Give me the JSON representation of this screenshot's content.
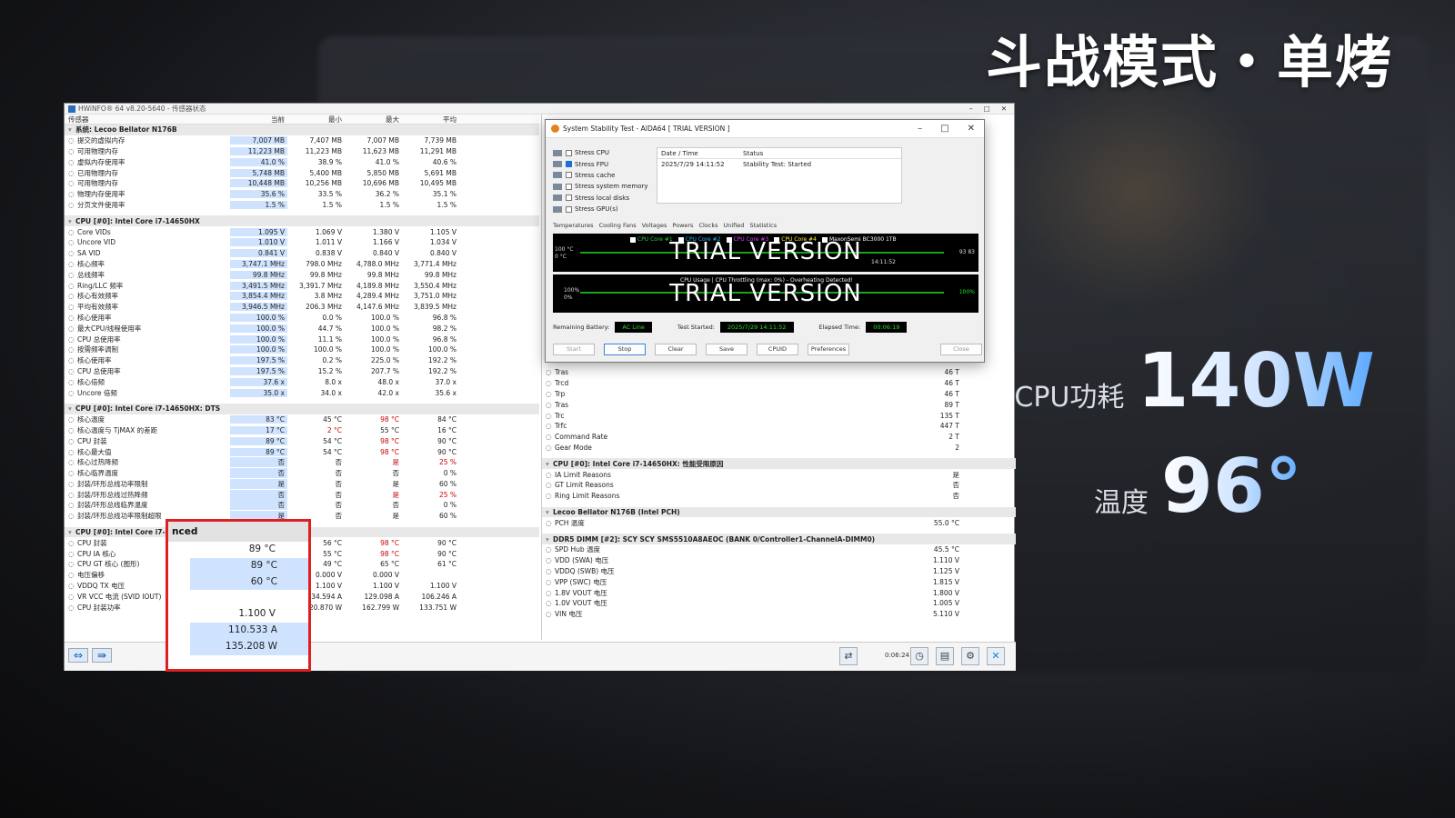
{
  "overlay": {
    "headline": "斗战模式・单烤",
    "cpu_power_label": "CPU功耗",
    "cpu_power_value": "140W",
    "temp_label": "温度",
    "temp_value": "96°"
  },
  "hwinfo": {
    "title": "HWiNFO® 64 v8.20-5640 - 传感器状态",
    "columns": [
      "传感器",
      "当前",
      "最小",
      "最大",
      "平均"
    ],
    "left_rows": [
      {
        "t": "g",
        "n": "系统: Lecoo Bellator N176B"
      },
      {
        "n": "提交的虚拟内存",
        "v": [
          "7,007 MB",
          "7,407 MB",
          "7,007 MB",
          "7,739 MB"
        ]
      },
      {
        "n": "可用物理内存",
        "v": [
          "11,223 MB",
          "11,223 MB",
          "11,623 MB",
          "11,291 MB"
        ]
      },
      {
        "n": "虚拟内存使用率",
        "v": [
          "41.0 %",
          "38.9 %",
          "41.0 %",
          "40.6 %"
        ]
      },
      {
        "n": "已用物理内存",
        "v": [
          "5,748 MB",
          "5,400 MB",
          "5,850 MB",
          "5,691 MB"
        ]
      },
      {
        "n": "可用物理内存",
        "v": [
          "10,448 MB",
          "10,256 MB",
          "10,696 MB",
          "10,495 MB"
        ]
      },
      {
        "n": "物理内存使用率",
        "v": [
          "35.6 %",
          "33.5 %",
          "36.2 %",
          "35.1 %"
        ]
      },
      {
        "n": "分页文件使用率",
        "v": [
          "1.5 %",
          "1.5 %",
          "1.5 %",
          "1.5 %"
        ]
      },
      {
        "t": "gap"
      },
      {
        "t": "g",
        "n": "CPU [#0]: Intel Core i7-14650HX"
      },
      {
        "n": "Core VIDs",
        "v": [
          "1.095 V",
          "1.069 V",
          "1.380 V",
          "1.105 V"
        ]
      },
      {
        "n": "Uncore VID",
        "v": [
          "1.010 V",
          "1.011 V",
          "1.166 V",
          "1.034 V"
        ]
      },
      {
        "n": "SA VID",
        "v": [
          "0.841 V",
          "0.838 V",
          "0.840 V",
          "0.840 V"
        ]
      },
      {
        "n": "核心频率",
        "v": [
          "3,747.1 MHz",
          "798.0 MHz",
          "4,788.0 MHz",
          "3,771.4 MHz"
        ]
      },
      {
        "n": "总线频率",
        "v": [
          "99.8 MHz",
          "99.8 MHz",
          "99.8 MHz",
          "99.8 MHz"
        ]
      },
      {
        "n": "Ring/LLC 频率",
        "v": [
          "3,491.5 MHz",
          "3,391.7 MHz",
          "4,189.8 MHz",
          "3,550.4 MHz"
        ]
      },
      {
        "n": "核心有效频率",
        "v": [
          "3,854.4 MHz",
          "3.8 MHz",
          "4,289.4 MHz",
          "3,751.0 MHz"
        ]
      },
      {
        "n": "平均有效频率",
        "v": [
          "3,946.5 MHz",
          "206.3 MHz",
          "4,147.6 MHz",
          "3,839.5 MHz"
        ]
      },
      {
        "n": "核心使用率",
        "v": [
          "100.0 %",
          "0.0 %",
          "100.0 %",
          "96.8 %"
        ]
      },
      {
        "n": "最大CPU/线程使用率",
        "v": [
          "100.0 %",
          "44.7 %",
          "100.0 %",
          "98.2 %"
        ]
      },
      {
        "n": "CPU 总使用率",
        "v": [
          "100.0 %",
          "11.1 %",
          "100.0 %",
          "96.8 %"
        ]
      },
      {
        "n": "按需频率调制",
        "v": [
          "100.0 %",
          "100.0 %",
          "100.0 %",
          "100.0 %"
        ]
      },
      {
        "n": "核心使用率",
        "v": [
          "197.5 %",
          "0.2 %",
          "225.0 %",
          "192.2 %"
        ]
      },
      {
        "n": "CPU 总使用率",
        "v": [
          "197.5 %",
          "15.2 %",
          "207.7 %",
          "192.2 %"
        ]
      },
      {
        "n": "核心倍频",
        "v": [
          "37.6 x",
          "8.0 x",
          "48.0 x",
          "37.0 x"
        ]
      },
      {
        "n": "Uncore 倍频",
        "v": [
          "35.0 x",
          "34.0 x",
          "42.0 x",
          "35.6 x"
        ]
      },
      {
        "t": "gap"
      },
      {
        "t": "g",
        "n": "CPU [#0]: Intel Core i7-14650HX: DTS"
      },
      {
        "n": "核心温度",
        "v": [
          "83 °C",
          "45 °C",
          "98 °C",
          "84 °C"
        ],
        "r": [
          2
        ]
      },
      {
        "n": "核心温度与 TjMAX 的差距",
        "v": [
          "17 °C",
          "2 °C",
          "55 °C",
          "16 °C"
        ],
        "r": [
          1
        ]
      },
      {
        "n": "CPU 封装",
        "v": [
          "89 °C",
          "54 °C",
          "98 °C",
          "90 °C"
        ],
        "r": [
          2
        ]
      },
      {
        "n": "核心最大值",
        "v": [
          "89 °C",
          "54 °C",
          "98 °C",
          "90 °C"
        ],
        "r": [
          2
        ]
      },
      {
        "n": "核心过热降频",
        "v": [
          "否",
          "否",
          "是",
          "25 %"
        ],
        "r": [
          2,
          3
        ]
      },
      {
        "n": "核心临界温度",
        "v": [
          "否",
          "否",
          "否",
          "0 %"
        ]
      },
      {
        "n": "封装/环形总线功率限制",
        "v": [
          "是",
          "否",
          "是",
          "60 %"
        ]
      },
      {
        "n": "封装/环形总线过热降频",
        "v": [
          "否",
          "否",
          "是",
          "25 %"
        ],
        "r": [
          2,
          3
        ]
      },
      {
        "n": "封装/环形总线临界温度",
        "v": [
          "否",
          "否",
          "否",
          "0 %"
        ]
      },
      {
        "n": "封装/环形总线功率限制超限",
        "v": [
          "是",
          "否",
          "是",
          "60 %"
        ]
      },
      {
        "t": "gap"
      },
      {
        "t": "g",
        "n": "CPU [#0]: Intel Core i7-14650HX: Enhanced"
      },
      {
        "n": "CPU 封装",
        "v": [
          "89 °C",
          "56 °C",
          "98 °C",
          "90 °C"
        ],
        "r": [
          2
        ]
      },
      {
        "n": "CPU IA 核心",
        "v": [
          "89 °C",
          "55 °C",
          "98 °C",
          "90 °C"
        ],
        "r": [
          2
        ]
      },
      {
        "n": "CPU GT 核心 (图形)",
        "v": [
          "60 °C",
          "49 °C",
          "65 °C",
          "61 °C"
        ]
      },
      {
        "n": "电压偏移",
        "v": [
          "",
          "0.000 V",
          "0.000 V",
          ""
        ]
      },
      {
        "n": "VDDQ TX 电压",
        "v": [
          "1.100 V",
          "1.100 V",
          "1.100 V",
          "1.100 V"
        ]
      },
      {
        "n": "VR VCC 电流 (SVID IOUT)",
        "v": [
          "110.533 A",
          "34.594 A",
          "129.098 A",
          "106.246 A"
        ]
      },
      {
        "n": "CPU 封装功率",
        "v": [
          "135.208 W",
          "20.870 W",
          "162.799 W",
          "133.751 W"
        ]
      }
    ],
    "right_rows": [
      {
        "n": "Tras",
        "v": "46 T"
      },
      {
        "n": "Trcd",
        "v": "46 T"
      },
      {
        "n": "Trp",
        "v": "46 T"
      },
      {
        "n": "Tras",
        "v": "89 T"
      },
      {
        "n": "Trc",
        "v": "135 T"
      },
      {
        "n": "Trfc",
        "v": "447 T"
      },
      {
        "n": "Command Rate",
        "v": "2 T"
      },
      {
        "n": "Gear Mode",
        "v": "2"
      },
      {
        "t": "gap"
      },
      {
        "t": "g",
        "n": "CPU [#0]: Intel Core i7-14650HX: 性能受限原因"
      },
      {
        "n": "IA Limit Reasons",
        "v": "是"
      },
      {
        "n": "GT Limit Reasons",
        "v": "否"
      },
      {
        "n": "Ring Limit Reasons",
        "v": "否"
      },
      {
        "t": "gap"
      },
      {
        "t": "g",
        "n": "Lecoo Bellator N176B (Intel PCH)"
      },
      {
        "n": "PCH 温度",
        "v": "55.0 °C"
      },
      {
        "t": "gap"
      },
      {
        "t": "g",
        "n": "DDR5 DIMM [#2]: SCY SCY SMS5510A8AEOC (BANK 0/Controller1-ChannelA-DIMM0)"
      },
      {
        "n": "SPD Hub 温度",
        "v": "45.5 °C"
      },
      {
        "n": "VDD (SWA) 电压",
        "v": "1.110 V"
      },
      {
        "n": "VDDQ (SWB) 电压",
        "v": "1.125 V"
      },
      {
        "n": "VPP (SWC) 电压",
        "v": "1.815 V"
      },
      {
        "n": "1.8V VOUT 电压",
        "v": "1.800 V"
      },
      {
        "n": "1.0V VOUT 电压",
        "v": "1.005 V"
      },
      {
        "n": "VIN 电压",
        "v": "5.110 V"
      }
    ],
    "timer": "0:06:24"
  },
  "highlight": {
    "header": "nced",
    "values": [
      "89 °C",
      "89 °C",
      "60 °C",
      "",
      "1.100 V",
      "110.533 A",
      "135.208 W"
    ]
  },
  "aida": {
    "title": "System Stability Test - AIDA64  [ TRIAL VERSION ]",
    "stress": [
      {
        "label": "Stress CPU",
        "on": false
      },
      {
        "label": "Stress FPU",
        "on": true
      },
      {
        "label": "Stress cache",
        "on": false
      },
      {
        "label": "Stress system memory",
        "on": false
      },
      {
        "label": "Stress local disks",
        "on": false
      },
      {
        "label": "Stress GPU(s)",
        "on": false
      }
    ],
    "log_header": [
      "Date / Time",
      "Status"
    ],
    "log_row": [
      "2025/7/29 14:11:52",
      "Stability Test: Started"
    ],
    "tabs": [
      "Temperatures",
      "Cooling Fans",
      "Voltages",
      "Powers",
      "Clocks",
      "Unified",
      "Statistics"
    ],
    "graph_legend": [
      "CPU Core #1",
      "CPU Core #2",
      "CPU Core #3",
      "CPU Core #4",
      "MaxonSemi BC3000 1TB"
    ],
    "graph1_ymax": "100 °C",
    "graph1_ymin": "0 °C",
    "graph1_time": "14:11:52",
    "graph1_right": "93 83",
    "graph2_legend": "CPU Usage  |  CPU Throttling (max: 0%) - Overheating Detected!",
    "graph2_ymax": "100%",
    "graph2_ymin": "0%",
    "graph2_right": "100%",
    "trial": "TRIAL VERSION",
    "battery_label": "Remaining Battery:",
    "battery_value": "AC Line",
    "started_label": "Test Started:",
    "started_value": "2025/7/29 14:11:52",
    "elapsed_label": "Elapsed Time:",
    "elapsed_value": "00:06:19",
    "buttons": [
      "Start",
      "Stop",
      "Clear",
      "Save",
      "CPUID",
      "Preferences",
      "Close"
    ]
  }
}
